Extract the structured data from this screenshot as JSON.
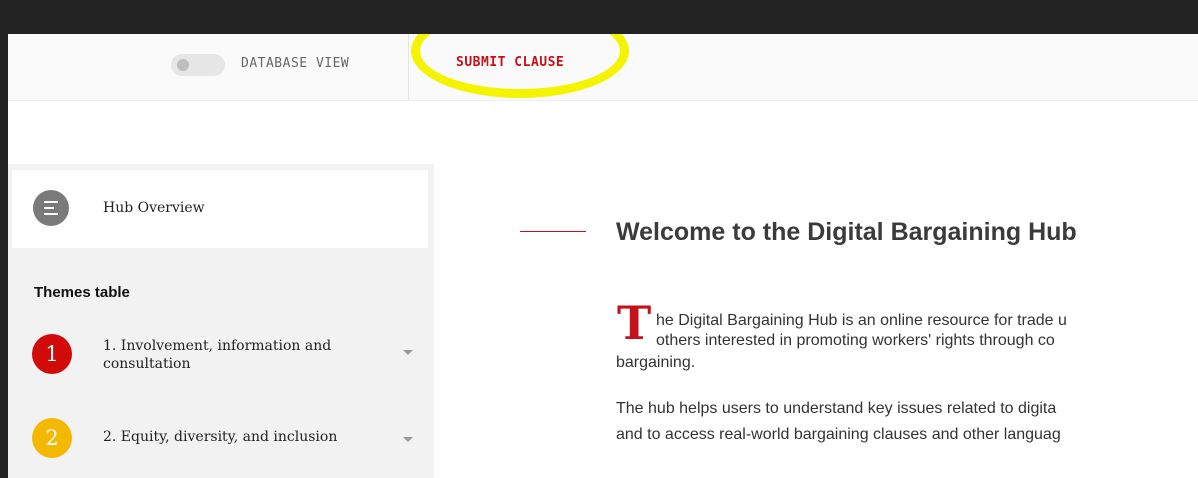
{
  "topbar": {
    "database_view_label": "DATABASE VIEW",
    "submit_clause_label": "SUBMIT CLAUSE"
  },
  "sidebar": {
    "overview_label": "Hub Overview",
    "themes_title": "Themes table",
    "themes": [
      {
        "number": "1",
        "label": "1. Involvement, information and consultation",
        "color": "#d10a0a"
      },
      {
        "number": "2",
        "label": "2. Equity, diversity, and inclusion",
        "color": "#f5b800"
      }
    ]
  },
  "main": {
    "title": "Welcome to the Digital Bargaining Hub",
    "dropcap": "T",
    "intro_line1": "he Digital Bargaining Hub is an online resource for trade u",
    "intro_line2": "others interested in promoting workers' rights through co",
    "intro_line3": "bargaining.",
    "para2_line1": "The hub helps users to understand key issues related to digita",
    "para2_line2": "and to access real-world bargaining clauses and other languag"
  },
  "colors": {
    "accent_red": "#c4111b",
    "highlight_yellow": "#f4f300",
    "frame_dark": "#222222"
  }
}
